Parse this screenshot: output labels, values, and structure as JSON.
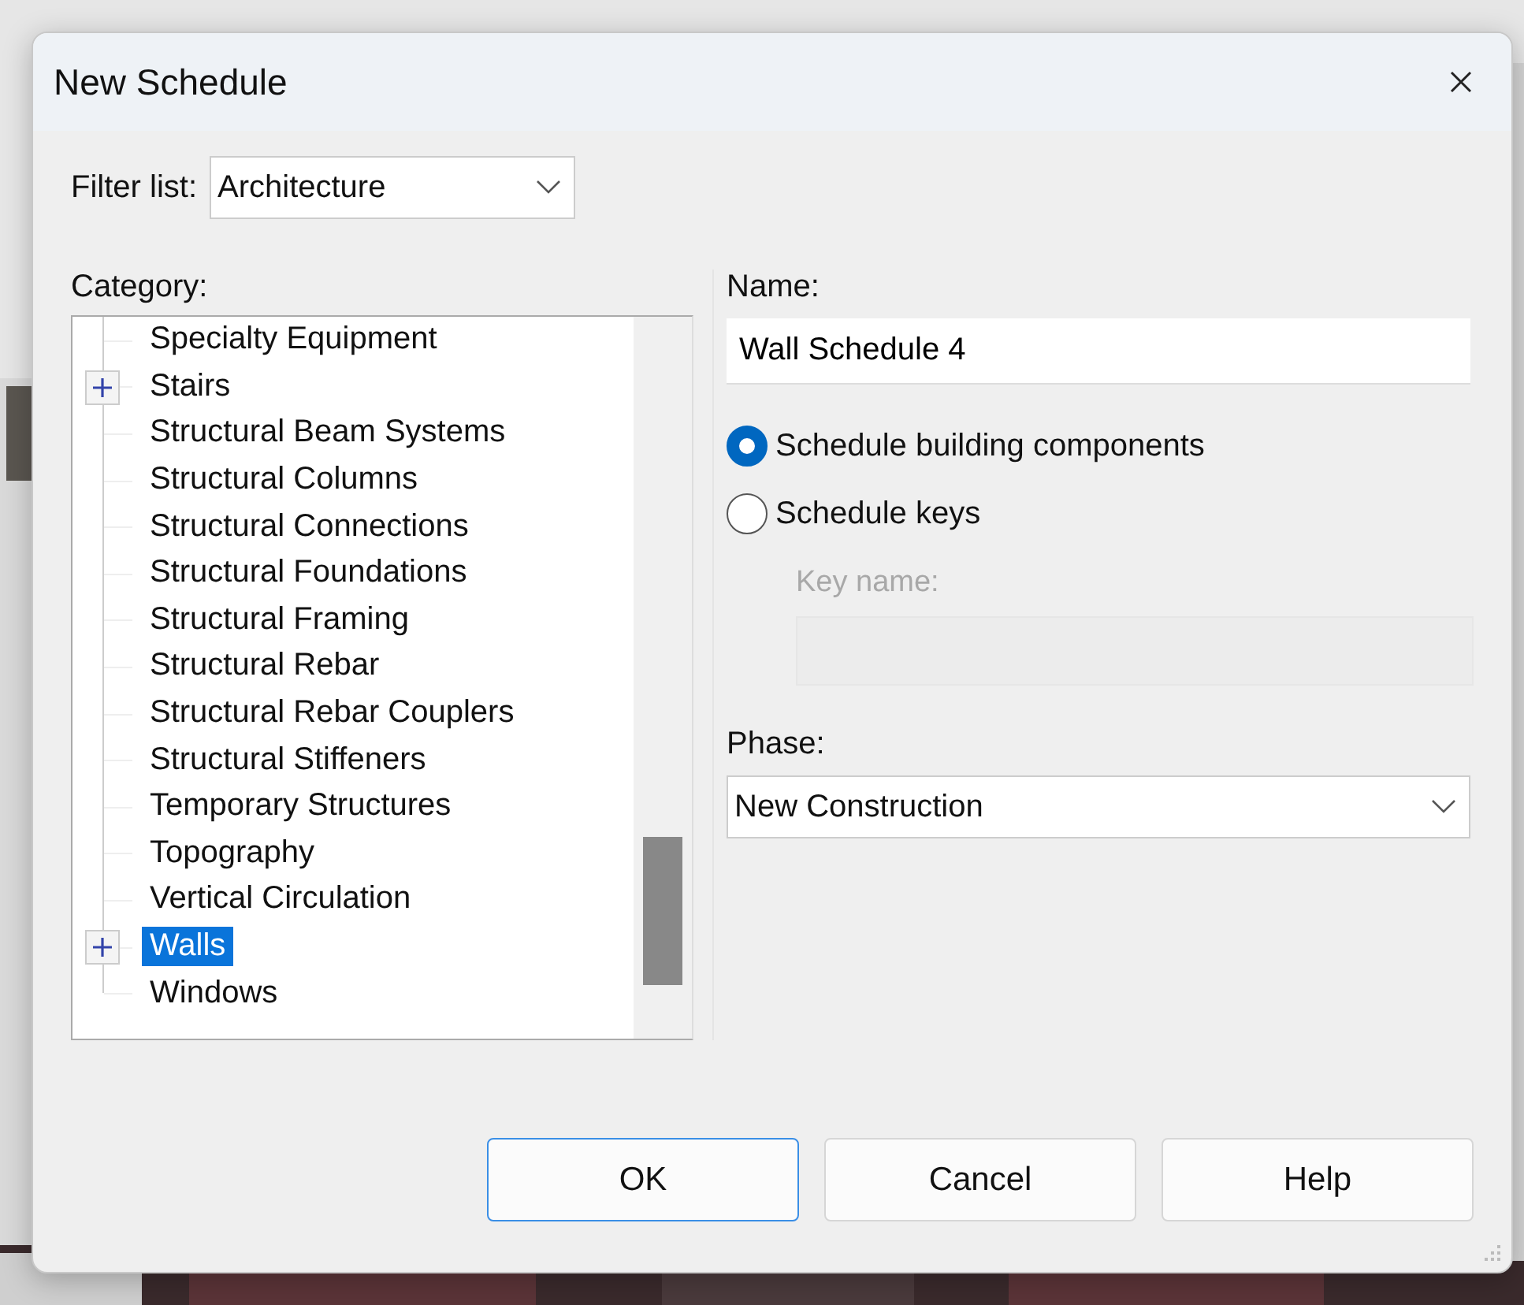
{
  "window": {
    "title": "New Schedule"
  },
  "filter": {
    "label": "Filter list:",
    "value": "Architecture"
  },
  "category": {
    "label": "Category:",
    "items": [
      {
        "label": "Specialty Equipment",
        "expandable": false,
        "selected": false
      },
      {
        "label": "Stairs",
        "expandable": true,
        "selected": false
      },
      {
        "label": "Structural Beam Systems",
        "expandable": false,
        "selected": false
      },
      {
        "label": "Structural Columns",
        "expandable": false,
        "selected": false
      },
      {
        "label": "Structural Connections",
        "expandable": false,
        "selected": false
      },
      {
        "label": "Structural Foundations",
        "expandable": false,
        "selected": false
      },
      {
        "label": "Structural Framing",
        "expandable": false,
        "selected": false
      },
      {
        "label": "Structural Rebar",
        "expandable": false,
        "selected": false
      },
      {
        "label": "Structural Rebar Couplers",
        "expandable": false,
        "selected": false
      },
      {
        "label": "Structural Stiffeners",
        "expandable": false,
        "selected": false
      },
      {
        "label": "Temporary Structures",
        "expandable": false,
        "selected": false
      },
      {
        "label": "Topography",
        "expandable": false,
        "selected": false
      },
      {
        "label": "Vertical Circulation",
        "expandable": false,
        "selected": false
      },
      {
        "label": "Walls",
        "expandable": true,
        "selected": true
      },
      {
        "label": "Windows",
        "expandable": false,
        "selected": false
      }
    ]
  },
  "name": {
    "label": "Name:",
    "value": "Wall Schedule 4"
  },
  "options": [
    {
      "label": "Schedule building components",
      "selected": true
    },
    {
      "label": "Schedule keys",
      "selected": false
    }
  ],
  "key_name": {
    "label": "Key name:",
    "disabled": true
  },
  "phase": {
    "label": "Phase:",
    "value": "New Construction"
  },
  "buttons": [
    {
      "label": "OK",
      "default": true
    },
    {
      "label": "Cancel",
      "default": false
    },
    {
      "label": "Help",
      "default": false
    }
  ]
}
